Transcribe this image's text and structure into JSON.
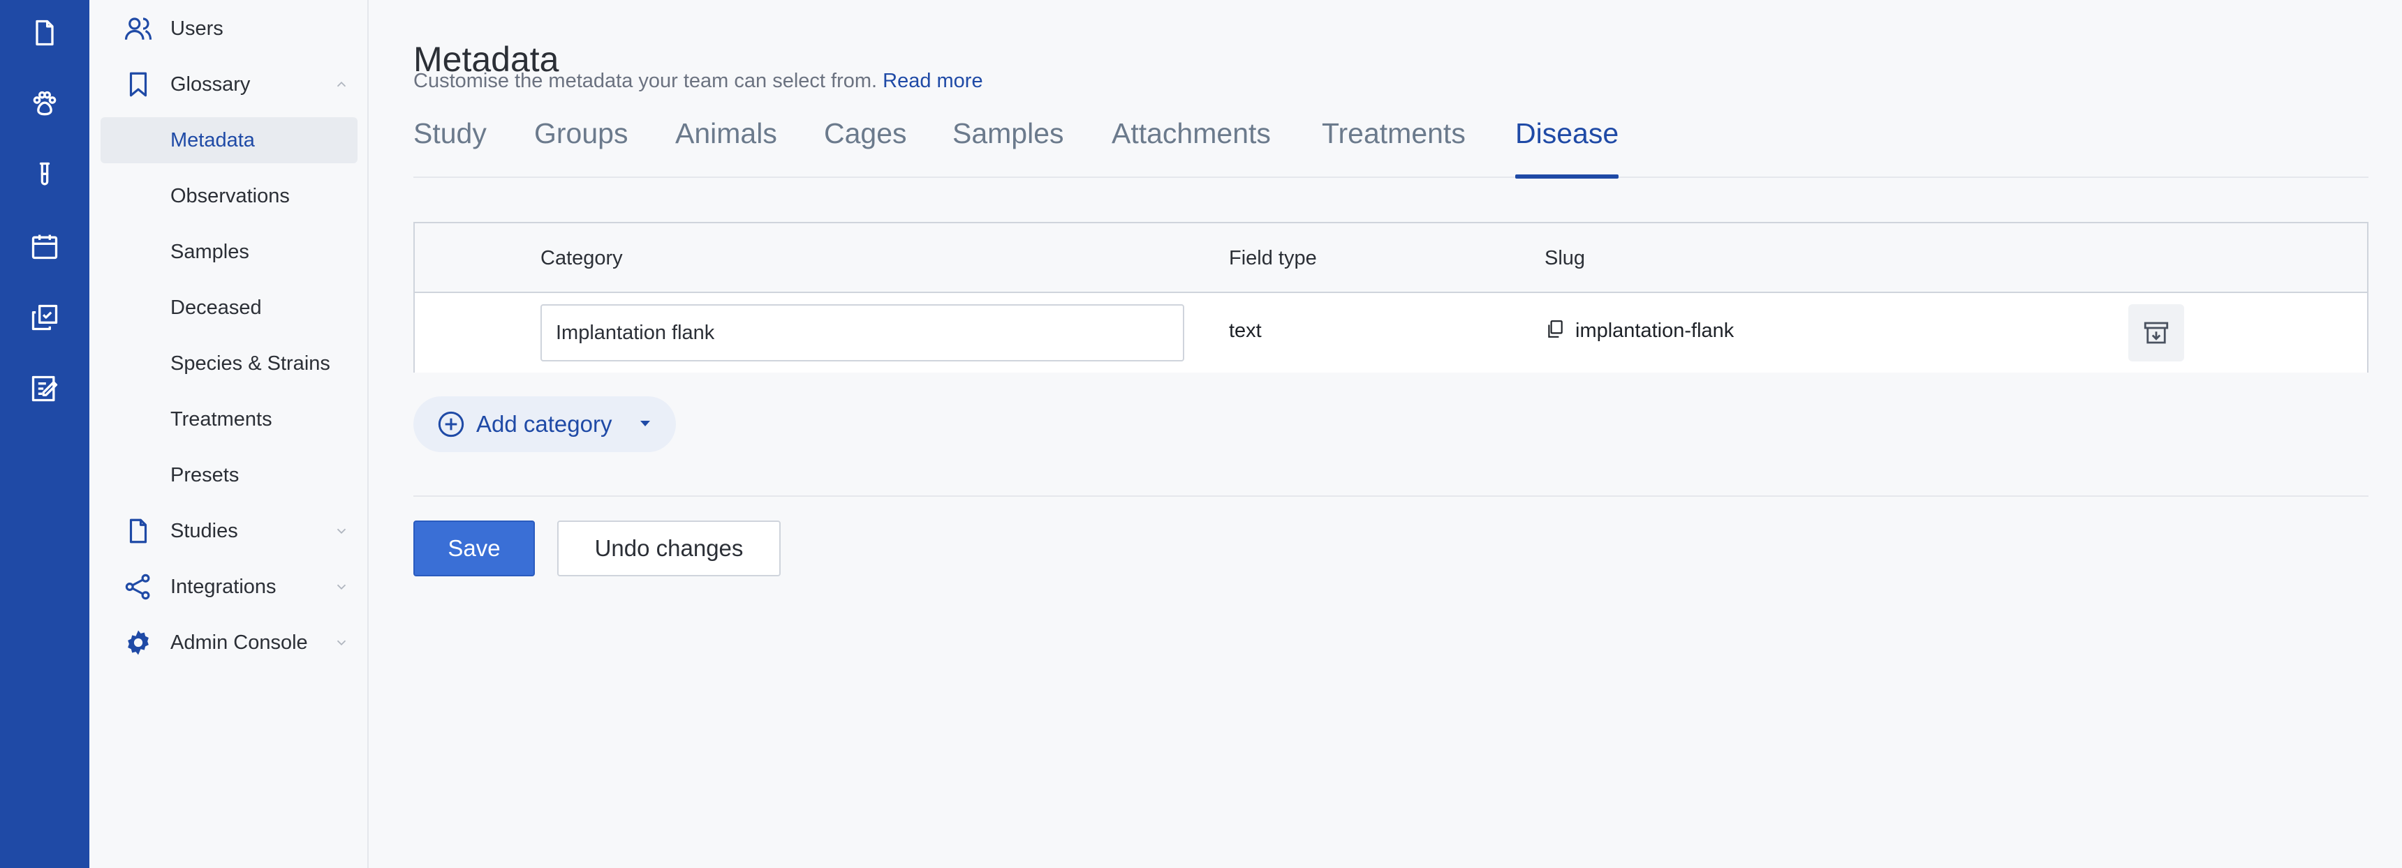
{
  "rail": {
    "icons": [
      "document-icon",
      "paw-icon",
      "test-tube-icon",
      "calendar-icon",
      "checklist-copy-icon",
      "edit-form-icon"
    ]
  },
  "sidebar": {
    "items": [
      {
        "label": "Users",
        "icon": "users-icon"
      },
      {
        "label": "Glossary",
        "icon": "bookmark-icon",
        "expanded": true
      },
      {
        "label": "Metadata",
        "active": true
      },
      {
        "label": "Observations"
      },
      {
        "label": "Samples"
      },
      {
        "label": "Deceased"
      },
      {
        "label": "Species & Strains"
      },
      {
        "label": "Treatments"
      },
      {
        "label": "Presets"
      },
      {
        "label": "Studies",
        "icon": "document-icon"
      },
      {
        "label": "Integrations",
        "icon": "share-icon"
      },
      {
        "label": "Admin Console",
        "icon": "gear-icon"
      }
    ]
  },
  "header": {
    "title": "Metadata",
    "subtitle": "Customise the metadata your team can select from.",
    "read_more": "Read more"
  },
  "tabs": [
    {
      "label": "Study"
    },
    {
      "label": "Groups"
    },
    {
      "label": "Animals"
    },
    {
      "label": "Cages"
    },
    {
      "label": "Samples"
    },
    {
      "label": "Attachments"
    },
    {
      "label": "Treatments"
    },
    {
      "label": "Disease",
      "active": true
    }
  ],
  "table": {
    "headers": {
      "category": "Category",
      "field_type": "Field type",
      "slug": "Slug"
    },
    "rows": [
      {
        "category": "Implantation flank",
        "field_type": "text",
        "slug": "implantation-flank"
      }
    ]
  },
  "actions": {
    "add_category": "Add category",
    "save": "Save",
    "undo": "Undo changes"
  },
  "colors": {
    "brand": "#1f4aa6",
    "save_button": "#3a6fd6"
  }
}
